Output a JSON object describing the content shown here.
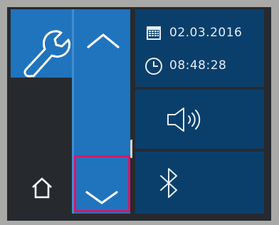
{
  "status": {
    "date": "02.03.2016",
    "time": "08:48:28"
  },
  "icons": {
    "settings": "wrench-icon",
    "home": "home-icon",
    "scroll_up": "chevron-up-icon",
    "scroll_down": "chevron-down-icon",
    "calendar": "calendar-icon",
    "clock": "clock-icon",
    "sound": "speaker-icon",
    "bluetooth": "bluetooth-icon"
  },
  "colors": {
    "accent": "#1f74bd",
    "tile_dark": "#0b3f6b",
    "background": "#262a2e",
    "bezel": "#a9a9a7",
    "highlight": "#d5176b"
  }
}
